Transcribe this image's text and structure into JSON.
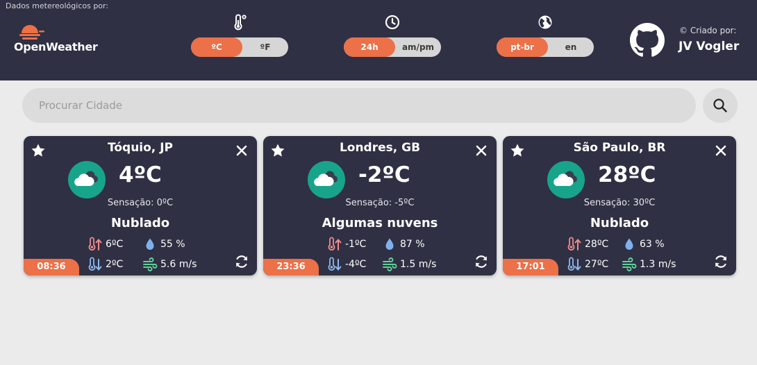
{
  "header": {
    "provider_label": "Dados metereológicos por:",
    "provider_name": "OpenWeather",
    "controls": [
      {
        "icon": "thermometer-icon",
        "active": "ºC",
        "inactive": "ºF"
      },
      {
        "icon": "clock-icon",
        "active": "24h",
        "inactive": "am/pm"
      },
      {
        "icon": "globe-icon",
        "active": "pt-br",
        "inactive": "en"
      }
    ],
    "created_label": "© Criado por:",
    "author": "JV Vogler"
  },
  "search": {
    "placeholder": "Procurar Cidade",
    "value": ""
  },
  "cards": [
    {
      "city": "Tóquio, JP",
      "temp": "4ºC",
      "feels": "Sensação: 0ºC",
      "condition": "Nublado",
      "max": "6ºC",
      "humidity": "55 %",
      "min": "2ºC",
      "wind": "5.6 m/s",
      "time": "08:36",
      "weather_icon": "cloudy-icon"
    },
    {
      "city": "Londres, GB",
      "temp": "-2ºC",
      "feels": "Sensação: -5ºC",
      "condition": "Algumas nuvens",
      "max": "-1ºC",
      "humidity": "87 %",
      "min": "-4ºC",
      "wind": "1.5 m/s",
      "time": "23:36",
      "weather_icon": "cloudy-icon"
    },
    {
      "city": "São Paulo, BR",
      "temp": "28ºC",
      "feels": "Sensação: 30ºC",
      "condition": "Nublado",
      "max": "28ºC",
      "humidity": "63 %",
      "min": "27ºC",
      "wind": "1.3 m/s",
      "time": "17:01",
      "weather_icon": "cloudy-icon"
    }
  ],
  "colors": {
    "header_bg": "#2f3043",
    "accent": "#ec7048",
    "weather_icon_bg": "#17a48b",
    "page_bg": "#ebebeb"
  }
}
